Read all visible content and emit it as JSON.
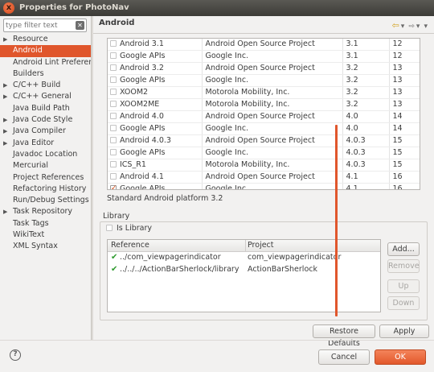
{
  "window": {
    "title": "Properties for PhotoNav",
    "close_glyph": "x"
  },
  "filter": {
    "placeholder": "type filter text"
  },
  "sidebar": {
    "items": [
      {
        "label": "Resource",
        "expandable": true
      },
      {
        "label": "Android",
        "expandable": false,
        "selected": true
      },
      {
        "label": "Android Lint Preferences",
        "expandable": false
      },
      {
        "label": "Builders",
        "expandable": false
      },
      {
        "label": "C/C++ Build",
        "expandable": true
      },
      {
        "label": "C/C++ General",
        "expandable": true
      },
      {
        "label": "Java Build Path",
        "expandable": false
      },
      {
        "label": "Java Code Style",
        "expandable": true
      },
      {
        "label": "Java Compiler",
        "expandable": true
      },
      {
        "label": "Java Editor",
        "expandable": true
      },
      {
        "label": "Javadoc Location",
        "expandable": false
      },
      {
        "label": "Mercurial",
        "expandable": false
      },
      {
        "label": "Project References",
        "expandable": false
      },
      {
        "label": "Refactoring History",
        "expandable": false
      },
      {
        "label": "Run/Debug Settings",
        "expandable": false
      },
      {
        "label": "Task Repository",
        "expandable": true
      },
      {
        "label": "Task Tags",
        "expandable": false
      },
      {
        "label": "WikiText",
        "expandable": false
      },
      {
        "label": "XML Syntax",
        "expandable": false
      }
    ]
  },
  "main": {
    "heading": "Android",
    "nav_icons": [
      "back-arrow-icon",
      "dropdown-icon",
      "forward-arrow-icon",
      "menu-dropdown-icon"
    ]
  },
  "targets": [
    {
      "name": "Android 3.1",
      "vendor": "Android Open Source Project",
      "platform": "3.1",
      "api": "12",
      "checked": false
    },
    {
      "name": "Google APIs",
      "vendor": "Google Inc.",
      "platform": "3.1",
      "api": "12",
      "checked": false
    },
    {
      "name": "Android 3.2",
      "vendor": "Android Open Source Project",
      "platform": "3.2",
      "api": "13",
      "checked": false
    },
    {
      "name": "Google APIs",
      "vendor": "Google Inc.",
      "platform": "3.2",
      "api": "13",
      "checked": false
    },
    {
      "name": "XOOM2",
      "vendor": "Motorola Mobility, Inc.",
      "platform": "3.2",
      "api": "13",
      "checked": false
    },
    {
      "name": "XOOM2ME",
      "vendor": "Motorola Mobility, Inc.",
      "platform": "3.2",
      "api": "13",
      "checked": false
    },
    {
      "name": "Android 4.0",
      "vendor": "Android Open Source Project",
      "platform": "4.0",
      "api": "14",
      "checked": false
    },
    {
      "name": "Google APIs",
      "vendor": "Google Inc.",
      "platform": "4.0",
      "api": "14",
      "checked": false
    },
    {
      "name": "Android 4.0.3",
      "vendor": "Android Open Source Project",
      "platform": "4.0.3",
      "api": "15",
      "checked": false
    },
    {
      "name": "Google APIs",
      "vendor": "Google Inc.",
      "platform": "4.0.3",
      "api": "15",
      "checked": false
    },
    {
      "name": "ICS_R1",
      "vendor": "Motorola Mobility, Inc.",
      "platform": "4.0.3",
      "api": "15",
      "checked": false
    },
    {
      "name": "Android 4.1",
      "vendor": "Android Open Source Project",
      "platform": "4.1",
      "api": "16",
      "checked": false
    },
    {
      "name": "Google APIs",
      "vendor": "Google Inc.",
      "platform": "4.1",
      "api": "16",
      "checked": true
    }
  ],
  "platform_description": "Standard Android platform 3.2",
  "library": {
    "title": "Library",
    "is_library_label": "Is Library",
    "is_library_checked": false,
    "columns": {
      "reference": "Reference",
      "project": "Project"
    },
    "rows": [
      {
        "reference": "../com_viewpagerindicator",
        "project": "com_viewpagerindicator"
      },
      {
        "reference": "../../../ActionBarSherlock/library",
        "project": "ActionBarSherlock"
      }
    ],
    "buttons": {
      "add": "Add...",
      "remove": "Remove",
      "up": "Up",
      "down": "Down"
    }
  },
  "actions": {
    "restore_defaults": "Restore Defaults",
    "apply": "Apply"
  },
  "footer": {
    "help_glyph": "?",
    "cancel": "Cancel",
    "ok": "OK"
  },
  "colors": {
    "accent": "#e0562c",
    "check": "#2e9a2e"
  }
}
